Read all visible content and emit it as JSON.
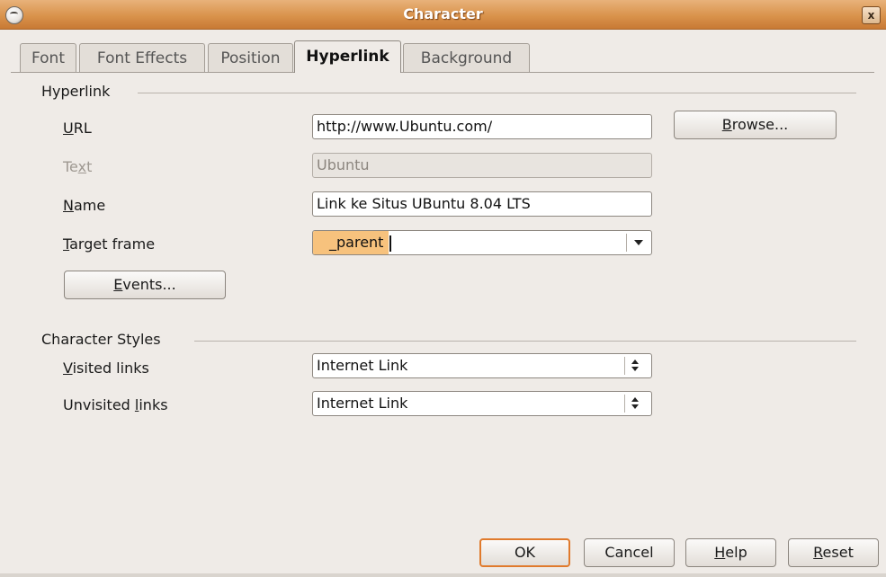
{
  "window": {
    "title": "Character",
    "close_label": "x"
  },
  "tabs": [
    {
      "label": "Font",
      "active": false
    },
    {
      "label": "Font Effects",
      "active": false
    },
    {
      "label": "Position",
      "active": false
    },
    {
      "label": "Hyperlink",
      "active": true
    },
    {
      "label": "Background",
      "active": false
    }
  ],
  "hyperlink": {
    "section_title": "Hyperlink",
    "url": {
      "label_prefix": "",
      "label_mnemonic": "U",
      "label_rest": "RL",
      "value": "http://www.Ubuntu.com/"
    },
    "browse": {
      "prefix": "",
      "mnemonic": "B",
      "rest": "rowse..."
    },
    "text": {
      "label_prefix": "Te",
      "label_mnemonic": "x",
      "label_rest": "t",
      "value": "Ubuntu"
    },
    "name": {
      "label_prefix": "",
      "label_mnemonic": "N",
      "label_rest": "ame",
      "value": "Link ke Situs UBuntu 8.04 LTS"
    },
    "target_frame": {
      "label_prefix": "",
      "label_mnemonic": "T",
      "label_rest": "arget frame",
      "value": "_parent"
    },
    "events": {
      "prefix": "",
      "mnemonic": "E",
      "rest": "vents..."
    }
  },
  "character_styles": {
    "section_title": "Character Styles",
    "visited": {
      "label_prefix": "",
      "label_mnemonic": "V",
      "label_rest": "isited links",
      "value": "Internet Link"
    },
    "unvisited": {
      "label_prefix": "Unvisited ",
      "label_mnemonic": "l",
      "label_rest": "inks",
      "value": "Internet Link"
    }
  },
  "buttons": {
    "ok": "OK",
    "cancel": "Cancel",
    "help": {
      "prefix": "",
      "mnemonic": "H",
      "rest": "elp"
    },
    "reset": {
      "prefix": "",
      "mnemonic": "R",
      "rest": "eset"
    }
  },
  "colors": {
    "titlebar": "#d9934c",
    "default_button_border": "#e07a2c",
    "highlight": "#f7c27d",
    "dialog_bg": "#efebe7"
  }
}
